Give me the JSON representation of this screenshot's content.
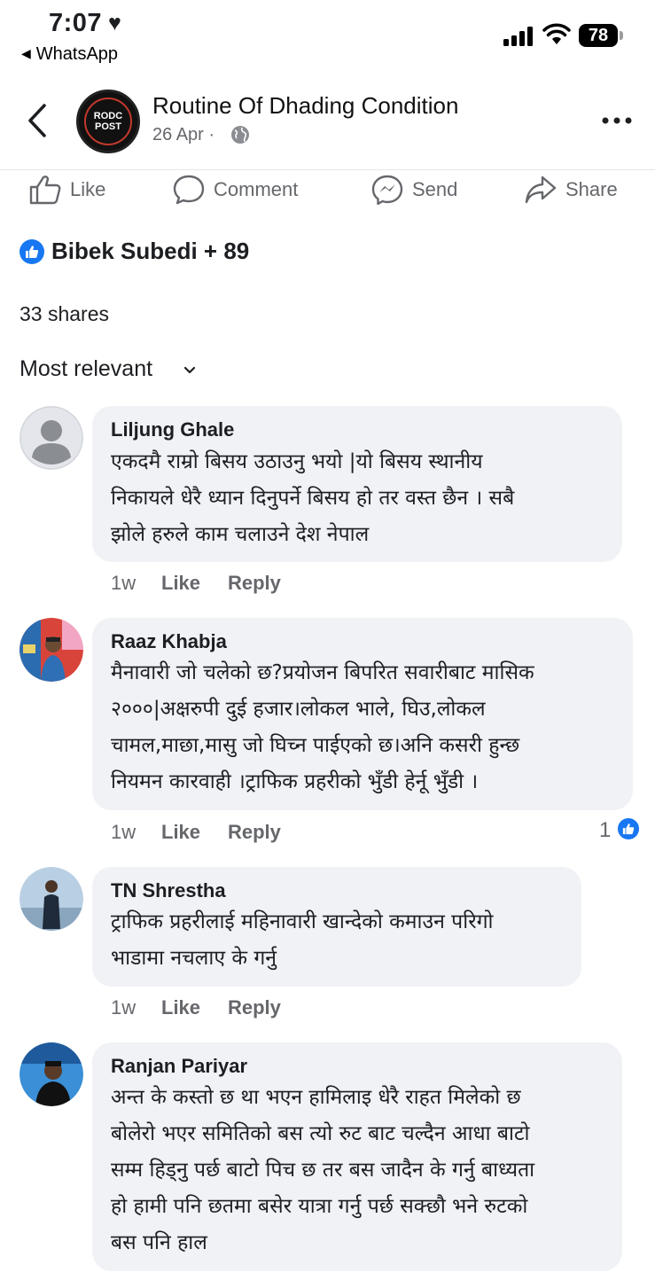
{
  "status_bar": {
    "time": "7:07",
    "heart": "♥",
    "back_app": "WhatsApp",
    "battery": "78"
  },
  "header": {
    "page_name": "Routine Of Dhading Condition",
    "date": "26 Apr",
    "separator": "·",
    "logo_line1": "RODC",
    "logo_line2": "POST",
    "audience_icon": "globe-icon"
  },
  "actions": {
    "like": "Like",
    "comment": "Comment",
    "send": "Send",
    "share": "Share"
  },
  "reactions": {
    "text": "Bibek Subedi + 89",
    "icon": "like-icon"
  },
  "shares": "33 shares",
  "sort": {
    "label": "Most relevant"
  },
  "comments": [
    {
      "name": "Liljung Ghale",
      "lines": [
        "एकदमै राम्रो बिसय उठाउनु भयाे  |याे बिसय  स्थानीय",
        "निकायले धेरै  ध्यान दिनुपर्ने बिसय हाे तर वस्त छैन । सबै",
        "झाेले हरुले काम चलाउने देश नेपाल"
      ],
      "time": "1w",
      "like": "Like",
      "reply": "Reply"
    },
    {
      "name": "Raaz Khabja",
      "lines": [
        "मैनावारी जो चलेको छ?प्रयोजन बिपरित  सवारीबाट मासिक",
        "२०००|अक्षरुपी दुई हजार।लोकल भाले, घिउ,लोकल",
        "चामल,माछा,मासु जो घिच्न पाईएको छ।अनि कसरी हुन्छ",
        "नियमन कारवाही ।ट्राफिक प्रहरीको भुँडी हेर्नू भुँडी ।"
      ],
      "time": "1w",
      "like": "Like",
      "reply": "Reply",
      "like_count": "1"
    },
    {
      "name": "TN Shrestha",
      "lines": [
        "ट्राफिक प्रहरीलाई महिनावारी खान्देको कमाउन परिगो",
        "भाडामा नचलाए के गर्नु"
      ],
      "time": "1w",
      "like": "Like",
      "reply": "Reply"
    },
    {
      "name": "Ranjan Pariyar",
      "lines": [
        "अन्त के कस्तो छ था भएन हामिलाइ धेरै राहत मिलेको छ",
        "बोलेरो भएर समितिको बस त्यो रुट बाट चल्दैन आधा बाटो",
        "सम्म हिड्नु पर्छ बाटो पिच छ तर बस जादैन के गर्नु बाध्यता",
        "हो हामी पनि छतमा बसेर यात्रा गर्नु पर्छ सक्छौ भने रुटको",
        "बस पनि हाल"
      ]
    }
  ],
  "colors": {
    "accent": "#1877f2",
    "bubble": "#f0f2f5",
    "muted": "#65676b"
  }
}
